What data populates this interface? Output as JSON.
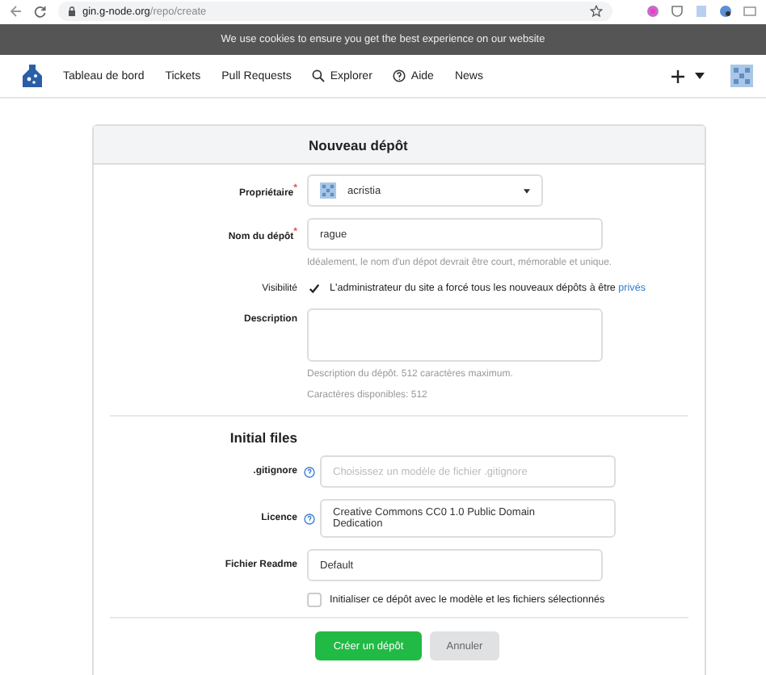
{
  "browser": {
    "url_host": "gin.g-node.org",
    "url_path": "/repo/create"
  },
  "cookie_banner": "We use cookies to ensure you get the best experience on our website",
  "nav": {
    "items": [
      {
        "label": "Tableau de bord",
        "kind": "plain"
      },
      {
        "label": "Tickets",
        "kind": "plain"
      },
      {
        "label": "Pull Requests",
        "kind": "plain"
      },
      {
        "label": "Explorer",
        "kind": "search"
      },
      {
        "label": "Aide",
        "kind": "help"
      },
      {
        "label": "News",
        "kind": "plain"
      }
    ]
  },
  "form": {
    "title": "Nouveau dépôt",
    "owner": {
      "label": "Propriétaire",
      "required_mark": "*",
      "value": "acristia"
    },
    "repo_name": {
      "label": "Nom du dépôt",
      "required_mark": "*",
      "value": "rague",
      "help": "Idéalement, le nom d'un dépot devrait être court, mémorable et unique."
    },
    "visibility": {
      "label": "Visibilité",
      "checked": true,
      "text": "L'administrateur du site a forcé tous les nouveaux dépôts à être",
      "link": "privés"
    },
    "description": {
      "label": "Description",
      "help": "Description du dépôt. 512 caractères maximum.",
      "remaining": "Caractères disponibles: 512"
    },
    "initial_files_title": "Initial files",
    "gitignore": {
      "label": ".gitignore",
      "placeholder": "Choisissez un modèle de fichier .gitignore"
    },
    "licence": {
      "label": "Licence",
      "value": "Creative Commons CC0 1.0 Public Domain Dedication"
    },
    "readme": {
      "label": "Fichier Readme",
      "value": "Default"
    },
    "init": {
      "label": "Initialiser ce dépôt avec le modèle et les fichiers sélectionnés",
      "checked": false
    },
    "buttons": [
      {
        "label": "Créer un dépôt",
        "kind": "primary"
      },
      {
        "label": "Annuler",
        "kind": "secondary"
      }
    ]
  }
}
